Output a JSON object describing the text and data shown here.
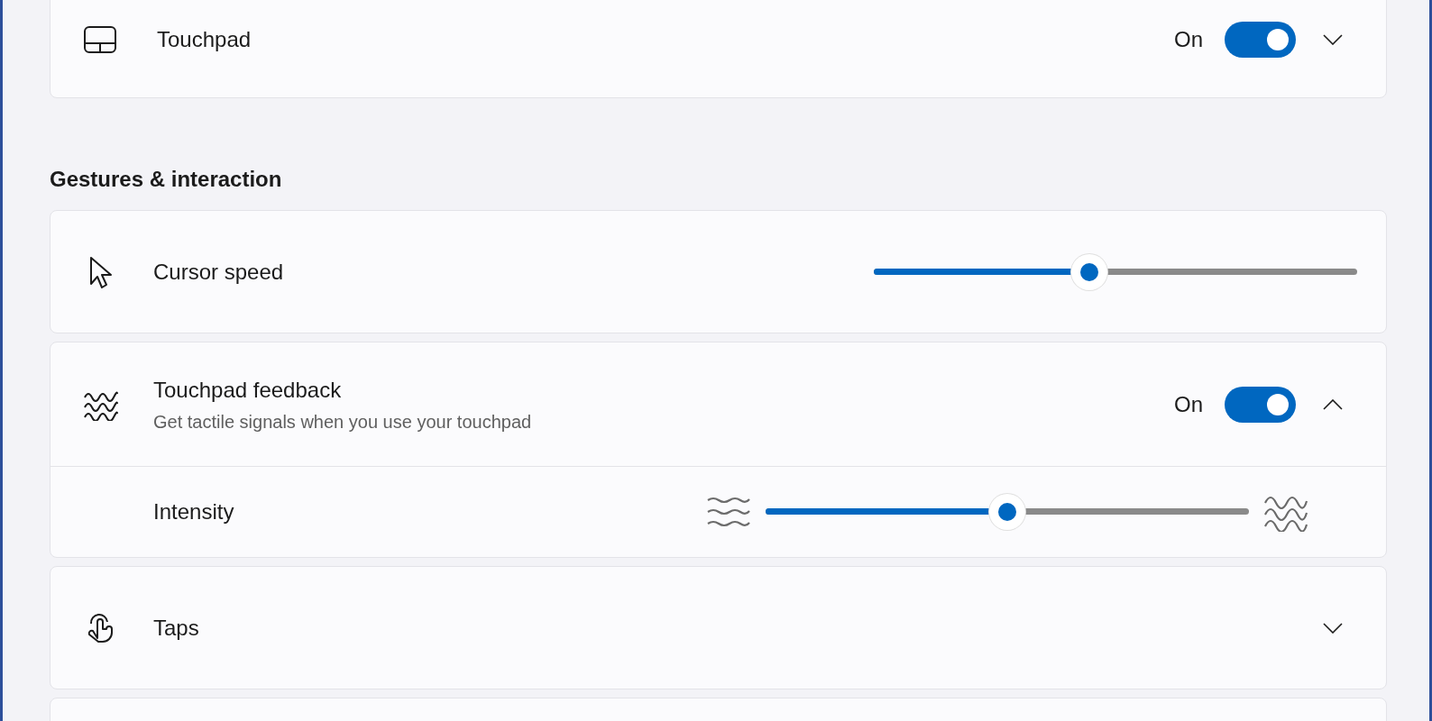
{
  "touchpad": {
    "label": "Touchpad",
    "state_label": "On",
    "on": true,
    "expanded": false
  },
  "section": {
    "title": "Gestures & interaction"
  },
  "cards": [
    {
      "kind": "slider",
      "label": "Cursor speed",
      "level": 0.446
    },
    {
      "kind": "toggle",
      "label": "Touchpad feedback",
      "description": "Get tactile signals when you use your touchpad",
      "state_label": "On",
      "on": true,
      "expanded": true,
      "sub": {
        "label": "Intensity",
        "level": 0.5
      }
    },
    {
      "kind": "expander",
      "label": "Taps",
      "expanded": false
    },
    {
      "kind": "blank"
    }
  ]
}
